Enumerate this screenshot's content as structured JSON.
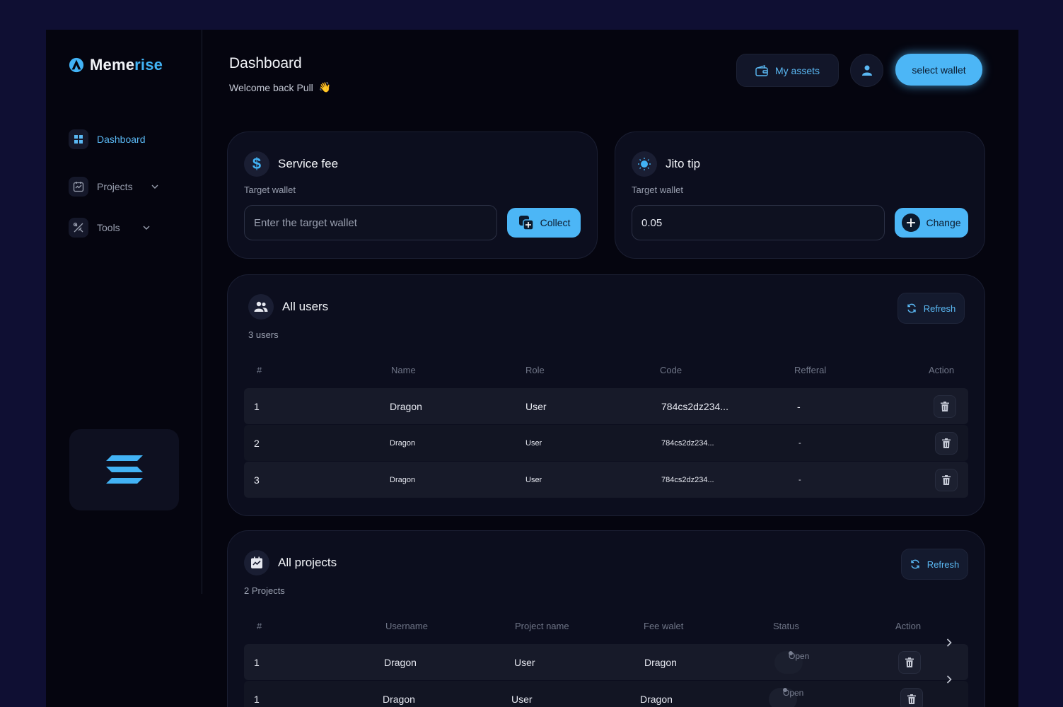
{
  "brand": {
    "name_part1": "Meme",
    "name_part2": "rise"
  },
  "sidebar": {
    "items": [
      {
        "label": "Dashboard",
        "icon": "dashboard-grid-icon"
      },
      {
        "label": "Projects",
        "icon": "projects-chart-icon"
      },
      {
        "label": "Tools",
        "icon": "tools-icon"
      }
    ]
  },
  "header": {
    "title": "Dashboard",
    "welcome": "Welcome back Pull",
    "wave_emoji": "👋",
    "my_assets_label": "My assets",
    "select_wallet_label": "select wallet"
  },
  "service_fee": {
    "title": "Service fee",
    "subtitle": "Target wallet",
    "input_placeholder": "Enter the target wallet",
    "input_value": "",
    "button_label": "Collect"
  },
  "jito_tip": {
    "title": "Jito tip",
    "subtitle": "Target wallet",
    "input_value": "0.05",
    "button_label": "Change"
  },
  "users": {
    "title": "All users",
    "count_label": "3 users",
    "refresh_label": "Refresh",
    "columns": [
      "#",
      "Name",
      "Role",
      "Code",
      "Refferal",
      "Action"
    ],
    "rows": [
      {
        "n": "1",
        "name": "Dragon",
        "role": "User",
        "code": "784cs2dz234...",
        "referral": "-"
      },
      {
        "n": "2",
        "name": "Dragon",
        "role": "User",
        "code": "784cs2dz234...",
        "referral": "-"
      },
      {
        "n": "3",
        "name": "Dragon",
        "role": "User",
        "code": "784cs2dz234...",
        "referral": "-"
      }
    ]
  },
  "projects": {
    "title": "All projects",
    "count_label": "2 Projects",
    "refresh_label": "Refresh",
    "columns": [
      "#",
      "Username",
      "Project name",
      "Fee walet",
      "Status",
      "Action"
    ],
    "rows": [
      {
        "n": "1",
        "username": "Dragon",
        "project": "User",
        "fee_wallet": "Dragon",
        "status": "Open"
      },
      {
        "n": "1",
        "username": "Dragon",
        "project": "User",
        "fee_wallet": "Dragon",
        "status": "Open"
      }
    ]
  },
  "colors": {
    "accent": "#4cb6f6",
    "background": "#05050f",
    "card": "#0c0e1e"
  }
}
